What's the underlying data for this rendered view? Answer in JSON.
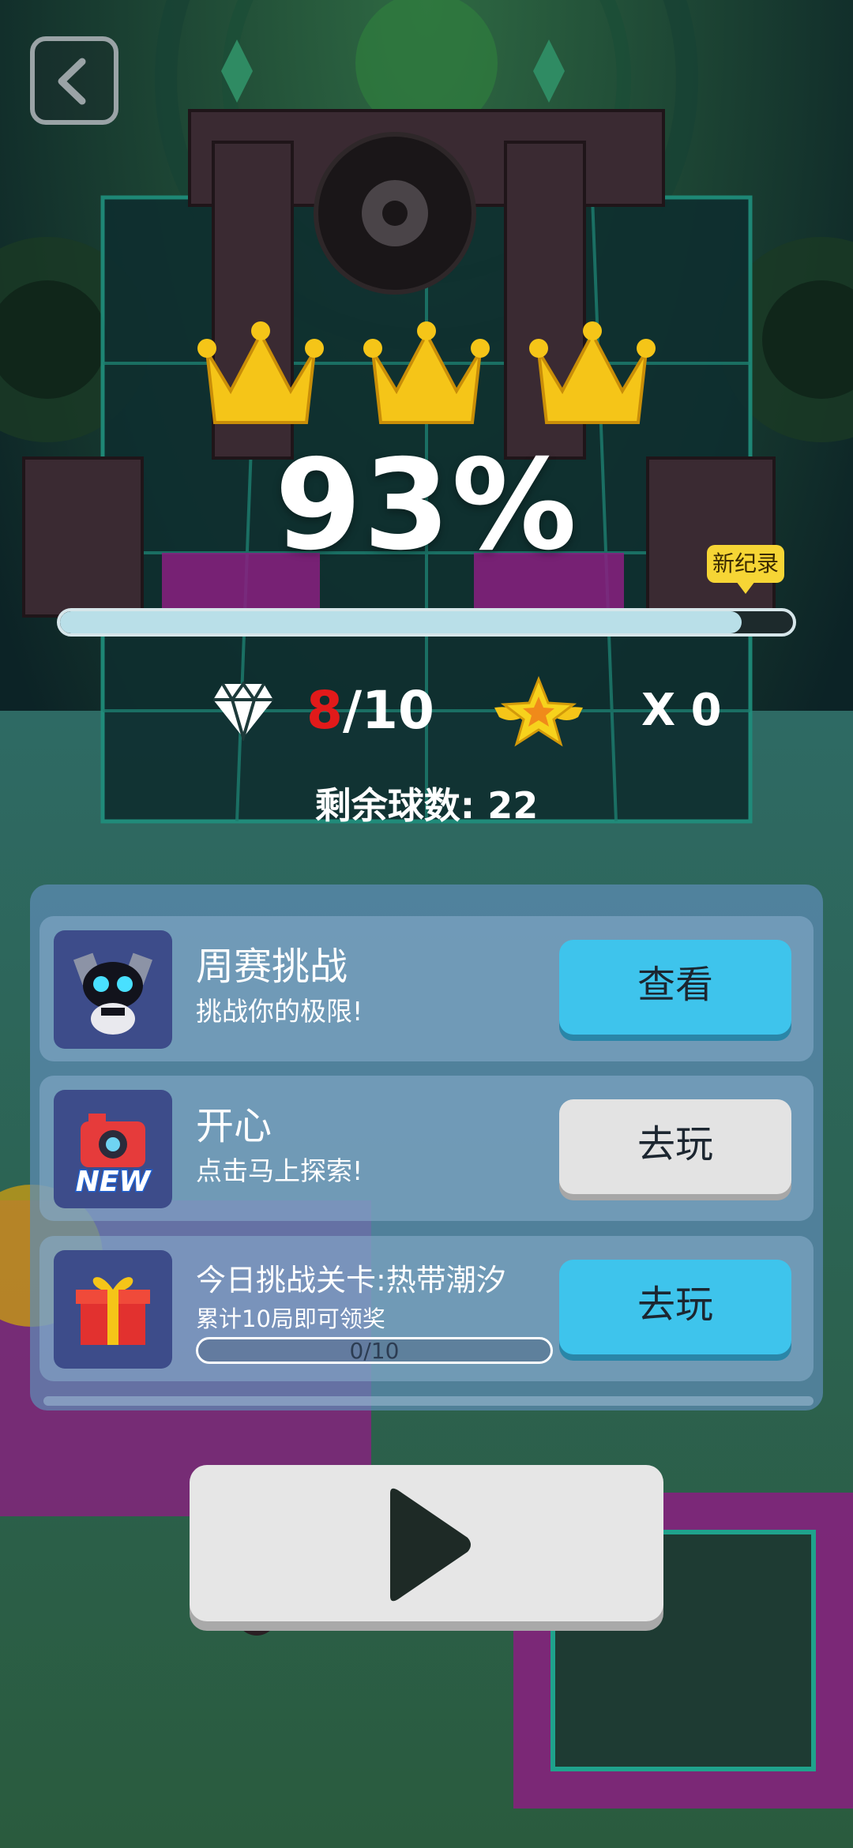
{
  "nav": {
    "back_icon": "chevron-left-icon"
  },
  "result": {
    "crowns_earned": 3,
    "crowns_total": 3,
    "percent_text": "93%",
    "progress": 0.93,
    "new_record_badge": "新纪录"
  },
  "stats": {
    "gems_current": "8",
    "gems_total_text": "/10",
    "star_multiplier": "X 0",
    "balls_left_label": "剩余球数: 22"
  },
  "panel": {
    "rows": [
      {
        "title": "周赛挑战",
        "subtitle": "挑战你的极限!",
        "button": "查看",
        "icon": "robot-icon",
        "button_color": "#3ec4ec"
      },
      {
        "title": "开心",
        "subtitle": "点击马上探索!",
        "button": "去玩",
        "icon": "new-camera-icon",
        "icon_text": "NEW",
        "button_color": "#e3e3e3"
      },
      {
        "title": "今日挑战关卡:热带潮汐",
        "subtitle": "累计10局即可领奖",
        "button": "去玩",
        "icon": "gift-box-icon",
        "progress_text": "0/10",
        "progress": 0,
        "button_color": "#3ec4ec"
      }
    ]
  },
  "play": {
    "icon": "play-icon"
  },
  "colors": {
    "accent_blue": "#3ec4ec",
    "gem_red": "#e11a1a",
    "crown_gold": "#f5c518",
    "badge_yellow": "#f6d535"
  }
}
